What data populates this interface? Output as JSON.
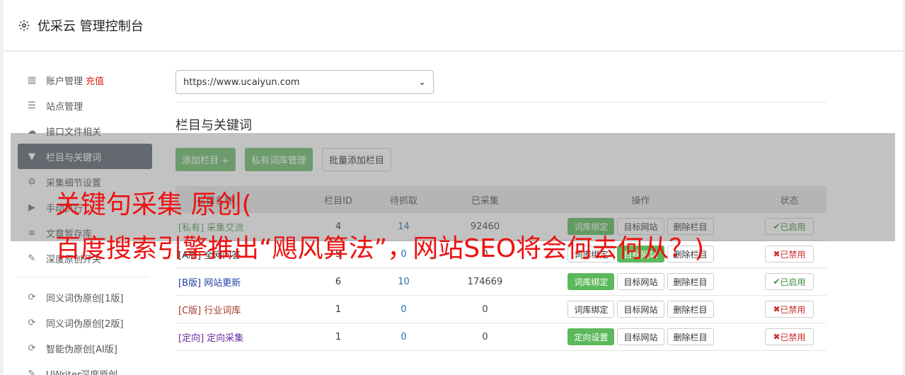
{
  "header": {
    "title": "优采云 管理控制台",
    "icon": "gear-icon"
  },
  "sidebar": {
    "items": [
      {
        "label": "账户管理",
        "extra": "充值",
        "icon": "bar-chart-icon"
      },
      {
        "label": "站点管理",
        "icon": "server-icon"
      },
      {
        "label": "接口文件相关",
        "icon": "cloud-upload-icon"
      },
      {
        "label": "栏目与关键词",
        "icon": "filter-icon",
        "active": true
      },
      {
        "label": "采集细节设置",
        "icon": "gears-icon"
      },
      {
        "label": "手动执行",
        "icon": "play-circle-icon"
      },
      {
        "label": "文章暂存库",
        "icon": "database-icon"
      },
      {
        "label": "深度原创开关",
        "icon": "edit-icon"
      }
    ],
    "items2": [
      {
        "label": "同义词伪原创[1版]",
        "icon": "refresh-icon"
      },
      {
        "label": "同义词伪原创[2版]",
        "icon": "refresh-icon"
      },
      {
        "label": "智能伪原创[AI版]",
        "icon": "refresh-icon"
      },
      {
        "label": "UWriter深度原创",
        "icon": "edit-icon"
      }
    ]
  },
  "main": {
    "site_select": "https://www.ucaiyun.com",
    "section_title": "栏目与关键词",
    "buttons": {
      "add_column": "添加栏目 +",
      "private_lib": "私有词库管理",
      "batch_add": "批量添加栏目"
    },
    "table": {
      "headers": {
        "name": "栏目名称",
        "id": "栏目ID",
        "wait": "待抓取",
        "done": "已采集",
        "ops": "操作",
        "status": "状态"
      },
      "rows": [
        {
          "tag": "[私有]",
          "name": "采集交流",
          "id": "4",
          "wait": "14",
          "done": "92460",
          "op1": "词库绑定",
          "op2": "目标网站",
          "op3": "删除栏目",
          "status": "已启用"
        },
        {
          "tag": "[A版]",
          "name": "全网问答",
          "id": "5",
          "wait": "0",
          "done": "0",
          "op1": "词库绑定",
          "op2": "目标网站",
          "op3": "删除栏目",
          "status": "已禁用"
        },
        {
          "tag": "[B版]",
          "name": "网站更新",
          "id": "6",
          "wait": "10",
          "done": "174669",
          "op1": "词库绑定",
          "op2": "目标网站",
          "op3": "删除栏目",
          "status": "已启用"
        },
        {
          "tag": "[C版]",
          "name": "行业词库",
          "id": "1",
          "wait": "0",
          "done": "0",
          "op1": "词库绑定",
          "op2": "目标网站",
          "op3": "删除栏目",
          "status": "已禁用"
        },
        {
          "tag": "[定向]",
          "name": "定向采集",
          "id": "1",
          "wait": "0",
          "done": "0",
          "op1": "定向设置",
          "op2": "目标网站",
          "op3": "删除栏目",
          "status": "已禁用"
        }
      ]
    }
  },
  "overlay": {
    "line1": "关键句采集 原创(",
    "line2": "百度搜索引擎推出“飓风算法”，网站SEO将会何去何从？)"
  },
  "colors": {
    "accent_green": "#5cb85c",
    "danger": "#c9302c",
    "active_bg": "#5c6770",
    "caption": "#ee1111"
  }
}
